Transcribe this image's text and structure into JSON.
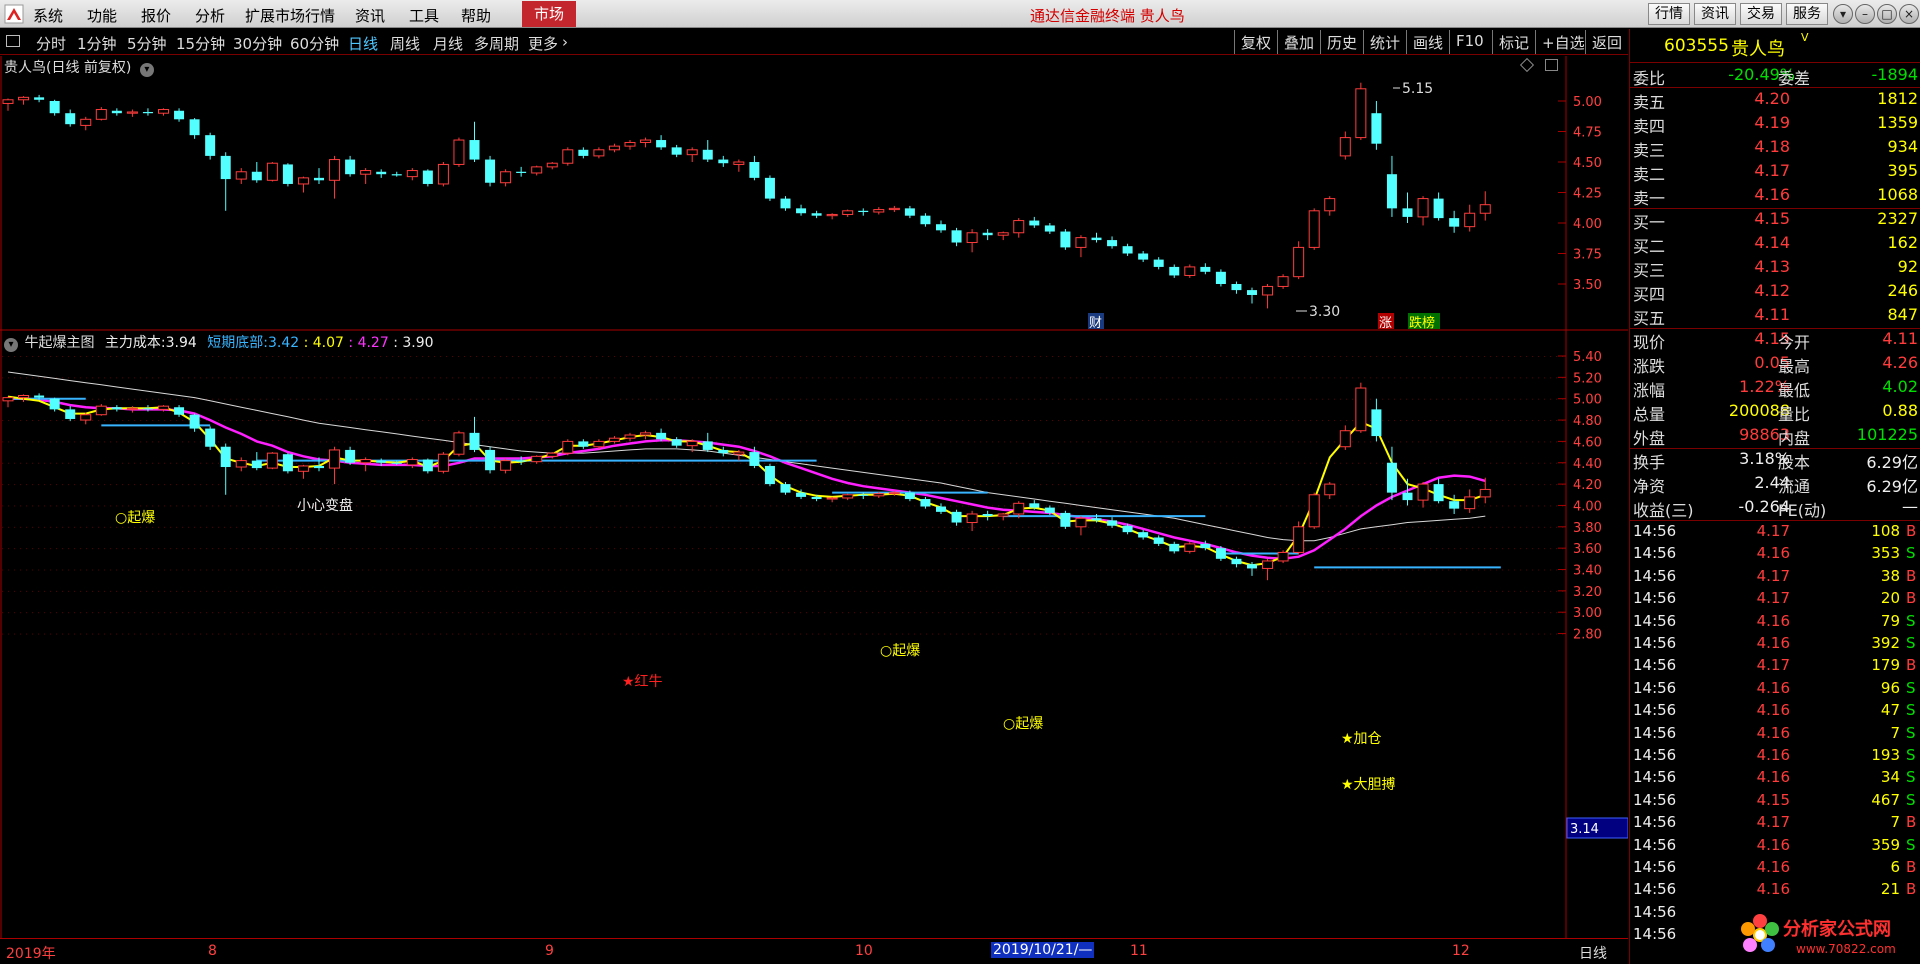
{
  "menu": {
    "items": [
      "系统",
      "功能",
      "报价",
      "分析",
      "扩展市场行情",
      "资讯",
      "工具",
      "帮助"
    ],
    "market": "市场",
    "app_title": "通达信金融终端  贵人鸟",
    "right_buttons": [
      "行情",
      "资讯",
      "交易",
      "服务"
    ]
  },
  "periods": [
    "分时",
    "1分钟",
    "5分钟",
    "15分钟",
    "30分钟",
    "60分钟",
    "日线",
    "周线",
    "月线",
    "多周期",
    "更多"
  ],
  "toolbar": [
    "复权",
    "叠加",
    "历史",
    "统计",
    "画线",
    "F10",
    "标记",
    "+自选",
    "返回"
  ],
  "upper": {
    "title": "贵人鸟(日线 前复权)",
    "ticks": [
      "5.00",
      "4.75",
      "4.50",
      "4.25",
      "4.00",
      "3.75",
      "3.50"
    ],
    "high_label": "5.15",
    "low_label": "3.30",
    "markers": {
      "cai": "财",
      "zhang": "涨",
      "dieban": "跌榜"
    }
  },
  "lower": {
    "title": "牛起爆主图",
    "cost_label": "主力成本:",
    "cost_value": "3.94",
    "short_label": "短期底部:",
    "v1": "3.42",
    "v2": "4.07",
    "v3": "4.27",
    "v4": "3.90",
    "ticks": [
      "5.40",
      "5.20",
      "5.00",
      "4.80",
      "4.60",
      "4.40",
      "4.20",
      "4.00",
      "3.80",
      "3.60",
      "3.40",
      "3.20",
      "3.00",
      "2.80"
    ],
    "cursor_value": "3.14",
    "annotations": {
      "qibao": "○起爆",
      "xiaoxin": "小心变盘",
      "hongniu": "★红牛",
      "jiacang": "★加仓",
      "dadan": "★大胆搏"
    }
  },
  "xaxis": {
    "labels": [
      "2019年",
      "8",
      "9",
      "10",
      "2019/10/21/—",
      "11",
      "12"
    ],
    "period": "日线"
  },
  "quote": {
    "code": "603555",
    "name": "贵人鸟",
    "weibi_label": "委比",
    "weibi": "-20.49%",
    "weicha_label": "委差",
    "weicha": "-1894",
    "asks": [
      {
        "label": "卖五",
        "price": "4.20",
        "vol": "1812"
      },
      {
        "label": "卖四",
        "price": "4.19",
        "vol": "1359"
      },
      {
        "label": "卖三",
        "price": "4.18",
        "vol": "934"
      },
      {
        "label": "卖二",
        "price": "4.17",
        "vol": "395"
      },
      {
        "label": "卖一",
        "price": "4.16",
        "vol": "1068"
      }
    ],
    "bids": [
      {
        "label": "买一",
        "price": "4.15",
        "vol": "2327"
      },
      {
        "label": "买二",
        "price": "4.14",
        "vol": "162"
      },
      {
        "label": "买三",
        "price": "4.13",
        "vol": "92"
      },
      {
        "label": "买四",
        "price": "4.12",
        "vol": "246"
      },
      {
        "label": "买五",
        "price": "4.11",
        "vol": "847"
      }
    ],
    "stats": [
      {
        "l1": "现价",
        "v1": "4.15",
        "c1": "red",
        "l2": "今开",
        "v2": "4.11",
        "c2": "red"
      },
      {
        "l1": "涨跌",
        "v1": "0.05",
        "c1": "red",
        "l2": "最高",
        "v2": "4.26",
        "c2": "red"
      },
      {
        "l1": "涨幅",
        "v1": "1.22%",
        "c1": "red",
        "l2": "最低",
        "v2": "4.02",
        "c2": "green"
      },
      {
        "l1": "总量",
        "v1": "200088",
        "c1": "yel",
        "l2": "量比",
        "v2": "0.88",
        "c2": "yel"
      },
      {
        "l1": "外盘",
        "v1": "98863",
        "c1": "red",
        "l2": "内盘",
        "v2": "101225",
        "c2": "green"
      }
    ],
    "stats2": [
      {
        "l1": "换手",
        "v1": "3.18%",
        "l2": "股本",
        "v2": "6.29亿"
      },
      {
        "l1": "净资",
        "v1": "2.44",
        "l2": "流通",
        "v2": "6.29亿"
      },
      {
        "l1": "收益(三)",
        "v1": "-0.264",
        "l2": "PE(动)",
        "v2": "—"
      }
    ],
    "ticks": [
      {
        "t": "14:56",
        "p": "4.17",
        "v": "108",
        "s": "B"
      },
      {
        "t": "14:56",
        "p": "4.16",
        "v": "353",
        "s": "S"
      },
      {
        "t": "14:56",
        "p": "4.17",
        "v": "38",
        "s": "B"
      },
      {
        "t": "14:56",
        "p": "4.17",
        "v": "20",
        "s": "B"
      },
      {
        "t": "14:56",
        "p": "4.16",
        "v": "79",
        "s": "S"
      },
      {
        "t": "14:56",
        "p": "4.16",
        "v": "392",
        "s": "S"
      },
      {
        "t": "14:56",
        "p": "4.17",
        "v": "179",
        "s": "B"
      },
      {
        "t": "14:56",
        "p": "4.16",
        "v": "96",
        "s": "S"
      },
      {
        "t": "14:56",
        "p": "4.16",
        "v": "47",
        "s": "S"
      },
      {
        "t": "14:56",
        "p": "4.16",
        "v": "7",
        "s": "S"
      },
      {
        "t": "14:56",
        "p": "4.16",
        "v": "193",
        "s": "S"
      },
      {
        "t": "14:56",
        "p": "4.16",
        "v": "34",
        "s": "S"
      },
      {
        "t": "14:56",
        "p": "4.15",
        "v": "467",
        "s": "S"
      },
      {
        "t": "14:56",
        "p": "4.17",
        "v": "7",
        "s": "B"
      },
      {
        "t": "14:56",
        "p": "4.16",
        "v": "359",
        "s": "S"
      },
      {
        "t": "14:56",
        "p": "4.16",
        "v": "6",
        "s": "B"
      },
      {
        "t": "14:56",
        "p": "4.16",
        "v": "21",
        "s": "B"
      },
      {
        "t": "14:56",
        "p": "",
        "v": "",
        "s": ""
      },
      {
        "t": "14:56",
        "p": "",
        "v": "",
        "s": ""
      }
    ]
  },
  "watermark": {
    "name": "分析家公式网",
    "url": "www.70822.com"
  },
  "candles": [
    [
      4.98,
      5.02,
      4.92,
      5.01
    ],
    [
      5.01,
      5.04,
      4.97,
      5.03
    ],
    [
      5.03,
      5.05,
      4.99,
      5.01
    ],
    [
      5.0,
      5.01,
      4.88,
      4.9
    ],
    [
      4.9,
      4.93,
      4.79,
      4.81
    ],
    [
      4.8,
      4.87,
      4.76,
      4.85
    ],
    [
      4.85,
      4.95,
      4.84,
      4.93
    ],
    [
      4.92,
      4.94,
      4.88,
      4.9
    ],
    [
      4.9,
      4.93,
      4.87,
      4.91
    ],
    [
      4.91,
      4.94,
      4.88,
      4.9
    ],
    [
      4.9,
      4.94,
      4.88,
      4.93
    ],
    [
      4.92,
      4.94,
      4.83,
      4.85
    ],
    [
      4.85,
      4.86,
      4.69,
      4.72
    ],
    [
      4.72,
      4.74,
      4.52,
      4.55
    ],
    [
      4.55,
      4.58,
      4.1,
      4.36
    ],
    [
      4.36,
      4.45,
      4.32,
      4.42
    ],
    [
      4.42,
      4.5,
      4.33,
      4.35
    ],
    [
      4.35,
      4.5,
      4.34,
      4.49
    ],
    [
      4.48,
      4.49,
      4.3,
      4.32
    ],
    [
      4.32,
      4.38,
      4.25,
      4.37
    ],
    [
      4.37,
      4.45,
      4.32,
      4.35
    ],
    [
      4.35,
      4.55,
      4.2,
      4.52
    ],
    [
      4.52,
      4.55,
      4.38,
      4.4
    ],
    [
      4.4,
      4.45,
      4.32,
      4.43
    ],
    [
      4.42,
      4.44,
      4.37,
      4.4
    ],
    [
      4.4,
      4.42,
      4.38,
      4.39
    ],
    [
      4.38,
      4.45,
      4.35,
      4.43
    ],
    [
      4.43,
      4.44,
      4.3,
      4.32
    ],
    [
      4.32,
      4.5,
      4.3,
      4.48
    ],
    [
      4.48,
      4.7,
      4.46,
      4.68
    ],
    [
      4.68,
      4.83,
      4.5,
      4.52
    ],
    [
      4.52,
      4.55,
      4.3,
      4.33
    ],
    [
      4.33,
      4.44,
      4.3,
      4.42
    ],
    [
      4.42,
      4.46,
      4.38,
      4.41
    ],
    [
      4.41,
      4.47,
      4.39,
      4.46
    ],
    [
      4.46,
      4.5,
      4.44,
      4.49
    ],
    [
      4.49,
      4.62,
      4.47,
      4.6
    ],
    [
      4.6,
      4.62,
      4.53,
      4.55
    ],
    [
      4.55,
      4.62,
      4.53,
      4.6
    ],
    [
      4.6,
      4.65,
      4.58,
      4.63
    ],
    [
      4.63,
      4.68,
      4.6,
      4.66
    ],
    [
      4.66,
      4.7,
      4.62,
      4.68
    ],
    [
      4.68,
      4.72,
      4.6,
      4.62
    ],
    [
      4.62,
      4.64,
      4.54,
      4.56
    ],
    [
      4.56,
      4.62,
      4.5,
      4.6
    ],
    [
      4.6,
      4.68,
      4.5,
      4.52
    ],
    [
      4.52,
      4.55,
      4.46,
      4.49
    ],
    [
      4.48,
      4.52,
      4.42,
      4.5
    ],
    [
      4.5,
      4.55,
      4.35,
      4.37
    ],
    [
      4.37,
      4.39,
      4.18,
      4.2
    ],
    [
      4.2,
      4.22,
      4.1,
      4.12
    ],
    [
      4.12,
      4.15,
      4.06,
      4.08
    ],
    [
      4.08,
      4.1,
      4.04,
      4.06
    ],
    [
      4.06,
      4.08,
      4.03,
      4.07
    ],
    [
      4.07,
      4.11,
      4.05,
      4.1
    ],
    [
      4.1,
      4.12,
      4.06,
      4.09
    ],
    [
      4.09,
      4.13,
      4.07,
      4.11
    ],
    [
      4.11,
      4.14,
      4.09,
      4.12
    ],
    [
      4.12,
      4.14,
      4.04,
      4.06
    ],
    [
      4.06,
      4.08,
      3.97,
      3.99
    ],
    [
      3.99,
      4.02,
      3.92,
      3.94
    ],
    [
      3.94,
      3.96,
      3.81,
      3.84
    ],
    [
      3.84,
      3.95,
      3.76,
      3.92
    ],
    [
      3.92,
      3.95,
      3.86,
      3.9
    ],
    [
      3.9,
      3.93,
      3.86,
      3.92
    ],
    [
      3.92,
      4.04,
      3.88,
      4.02
    ],
    [
      4.02,
      4.05,
      3.96,
      3.98
    ],
    [
      3.98,
      4.0,
      3.91,
      3.93
    ],
    [
      3.93,
      3.95,
      3.78,
      3.8
    ],
    [
      3.8,
      3.9,
      3.72,
      3.88
    ],
    [
      3.88,
      3.92,
      3.84,
      3.86
    ],
    [
      3.86,
      3.89,
      3.79,
      3.81
    ],
    [
      3.81,
      3.83,
      3.73,
      3.75
    ],
    [
      3.75,
      3.77,
      3.68,
      3.7
    ],
    [
      3.7,
      3.72,
      3.62,
      3.64
    ],
    [
      3.64,
      3.66,
      3.55,
      3.57
    ],
    [
      3.57,
      3.66,
      3.55,
      3.64
    ],
    [
      3.64,
      3.67,
      3.58,
      3.6
    ],
    [
      3.6,
      3.62,
      3.48,
      3.5
    ],
    [
      3.5,
      3.52,
      3.42,
      3.45
    ],
    [
      3.45,
      3.47,
      3.34,
      3.41
    ],
    [
      3.41,
      3.5,
      3.3,
      3.48
    ],
    [
      3.48,
      3.58,
      3.46,
      3.56
    ],
    [
      3.56,
      3.85,
      3.54,
      3.8
    ],
    [
      3.8,
      4.12,
      3.78,
      4.1
    ],
    [
      4.1,
      4.22,
      4.06,
      4.2
    ],
    [
      4.55,
      4.75,
      4.52,
      4.7
    ],
    [
      4.7,
      5.15,
      4.68,
      5.1
    ],
    [
      4.9,
      5.0,
      4.6,
      4.65
    ],
    [
      4.4,
      4.55,
      4.05,
      4.12
    ],
    [
      4.12,
      4.25,
      4.0,
      4.05
    ],
    [
      4.05,
      4.22,
      3.98,
      4.2
    ],
    [
      4.2,
      4.25,
      4.02,
      4.04
    ],
    [
      4.04,
      4.1,
      3.92,
      3.97
    ],
    [
      3.97,
      4.15,
      3.93,
      4.08
    ],
    [
      4.08,
      4.26,
      4.02,
      4.15
    ]
  ],
  "ma_yellow": [
    5.02,
    5.0,
    4.98,
    4.92,
    4.86,
    4.86,
    4.9,
    4.91,
    4.91,
    4.91,
    4.92,
    4.87,
    4.78,
    4.62,
    4.44,
    4.4,
    4.37,
    4.4,
    4.36,
    4.36,
    4.37,
    4.45,
    4.42,
    4.42,
    4.41,
    4.4,
    4.42,
    4.36,
    4.42,
    4.56,
    4.58,
    4.42,
    4.4,
    4.41,
    4.44,
    4.48,
    4.56,
    4.56,
    4.58,
    4.61,
    4.64,
    4.66,
    4.64,
    4.6,
    4.6,
    4.56,
    4.51,
    4.5,
    4.42,
    4.28,
    4.18,
    4.12,
    4.09,
    4.08,
    4.09,
    4.1,
    4.1,
    4.11,
    4.09,
    4.03,
    3.98,
    3.9,
    3.9,
    3.9,
    3.91,
    3.97,
    3.98,
    3.95,
    3.85,
    3.86,
    3.86,
    3.83,
    3.78,
    3.72,
    3.67,
    3.61,
    3.62,
    3.61,
    3.54,
    3.48,
    3.44,
    3.46,
    3.52,
    3.72,
    4.05,
    4.45,
    4.62,
    4.78,
    4.72,
    4.4,
    4.2,
    4.16,
    4.1,
    4.05,
    4.05,
    4.1
  ],
  "ma_magenta": [
    5.0,
    5.0,
    4.99,
    4.97,
    4.94,
    4.92,
    4.91,
    4.91,
    4.9,
    4.9,
    4.9,
    4.89,
    4.86,
    4.8,
    4.73,
    4.67,
    4.6,
    4.56,
    4.5,
    4.46,
    4.43,
    4.42,
    4.4,
    4.39,
    4.38,
    4.38,
    4.38,
    4.37,
    4.37,
    4.4,
    4.44,
    4.44,
    4.44,
    4.44,
    4.45,
    4.46,
    4.49,
    4.51,
    4.53,
    4.56,
    4.58,
    4.6,
    4.61,
    4.61,
    4.6,
    4.59,
    4.57,
    4.55,
    4.51,
    4.46,
    4.4,
    4.35,
    4.3,
    4.25,
    4.21,
    4.18,
    4.16,
    4.14,
    4.12,
    4.1,
    4.07,
    4.04,
    4.01,
    3.98,
    3.96,
    3.95,
    3.94,
    3.93,
    3.91,
    3.89,
    3.87,
    3.85,
    3.82,
    3.78,
    3.74,
    3.7,
    3.67,
    3.64,
    3.6,
    3.56,
    3.53,
    3.51,
    3.5,
    3.52,
    3.58,
    3.68,
    3.78,
    3.9,
    4.0,
    4.08,
    4.14,
    4.2,
    4.26,
    4.28,
    4.27,
    4.23
  ],
  "ma_white": [
    5.25,
    5.23,
    5.21,
    5.19,
    5.17,
    5.15,
    5.13,
    5.11,
    5.09,
    5.07,
    5.05,
    5.03,
    5.01,
    4.98,
    4.95,
    4.92,
    4.89,
    4.86,
    4.83,
    4.8,
    4.77,
    4.75,
    4.73,
    4.71,
    4.69,
    4.67,
    4.65,
    4.63,
    4.61,
    4.59,
    4.57,
    4.55,
    4.53,
    4.51,
    4.5,
    4.49,
    4.49,
    4.49,
    4.5,
    4.51,
    4.52,
    4.53,
    4.53,
    4.53,
    4.52,
    4.51,
    4.49,
    4.47,
    4.45,
    4.43,
    4.41,
    4.39,
    4.37,
    4.35,
    4.33,
    4.31,
    4.29,
    4.27,
    4.25,
    4.23,
    4.21,
    4.18,
    4.15,
    4.12,
    4.1,
    4.08,
    4.06,
    4.04,
    4.02,
    4.0,
    3.98,
    3.96,
    3.94,
    3.92,
    3.9,
    3.88,
    3.85,
    3.82,
    3.79,
    3.76,
    3.73,
    3.7,
    3.68,
    3.67,
    3.67,
    3.7,
    3.74,
    3.78,
    3.8,
    3.82,
    3.84,
    3.85,
    3.86,
    3.87,
    3.88,
    3.9
  ],
  "cyan_steps": [
    [
      5.0,
      0,
      5
    ],
    [
      4.75,
      6,
      13
    ],
    [
      4.42,
      16,
      52
    ],
    [
      4.12,
      53,
      63
    ],
    [
      3.9,
      64,
      77
    ],
    [
      3.55,
      78,
      83
    ],
    [
      3.42,
      84,
      96
    ]
  ]
}
